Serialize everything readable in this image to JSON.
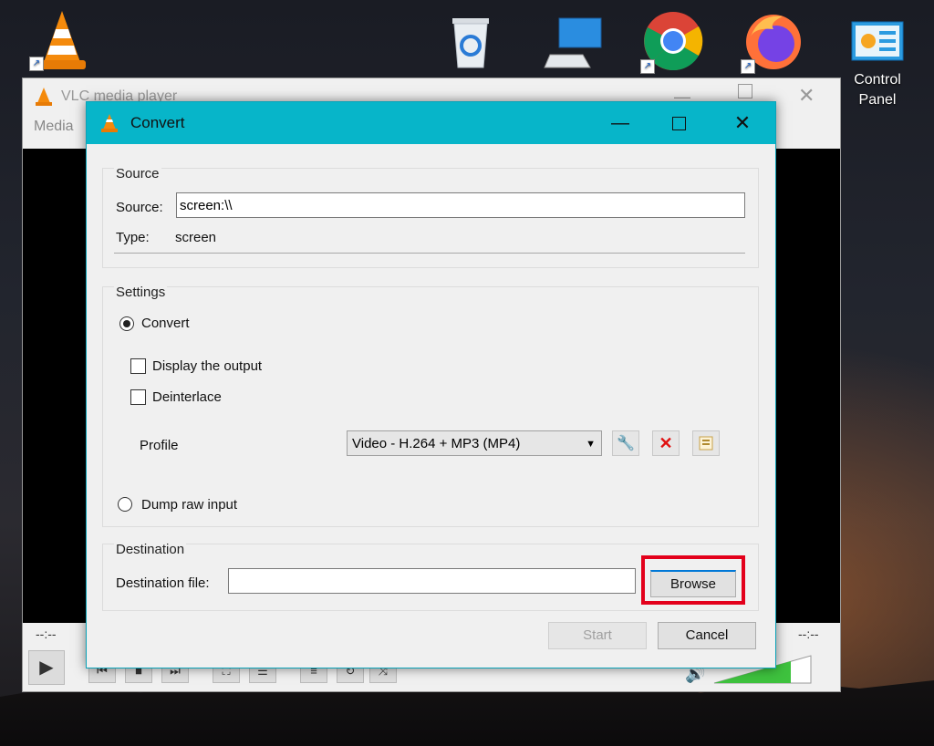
{
  "desktop": {
    "icons": [
      {
        "name": "vlc",
        "label": ""
      },
      {
        "name": "recycle-bin",
        "label": ""
      },
      {
        "name": "this-pc",
        "label": ""
      },
      {
        "name": "chrome",
        "label": ""
      },
      {
        "name": "firefox",
        "label": ""
      },
      {
        "name": "control-panel",
        "label": "Control Panel"
      }
    ]
  },
  "vlc_window": {
    "title": "VLC media player",
    "menu": "Media",
    "time_left": "--:--",
    "time_right": "--:--"
  },
  "dialog": {
    "title": "Convert",
    "source_group": {
      "title": "Source",
      "source_label": "Source:",
      "source_value": "screen:\\\\",
      "type_label": "Type:",
      "type_value": "screen"
    },
    "settings_group": {
      "title": "Settings",
      "convert_label": "Convert",
      "display_output_label": "Display the output",
      "deinterlace_label": "Deinterlace",
      "profile_label": "Profile",
      "profile_value": "Video - H.264 + MP3 (MP4)",
      "dump_raw_label": "Dump raw input"
    },
    "destination_group": {
      "title": "Destination",
      "dest_file_label": "Destination file:",
      "dest_file_value": "",
      "browse_label": "Browse"
    },
    "start_label": "Start",
    "cancel_label": "Cancel"
  },
  "colors": {
    "dialog_title_bar": "#07b5c9",
    "highlight": "#e3001b"
  }
}
